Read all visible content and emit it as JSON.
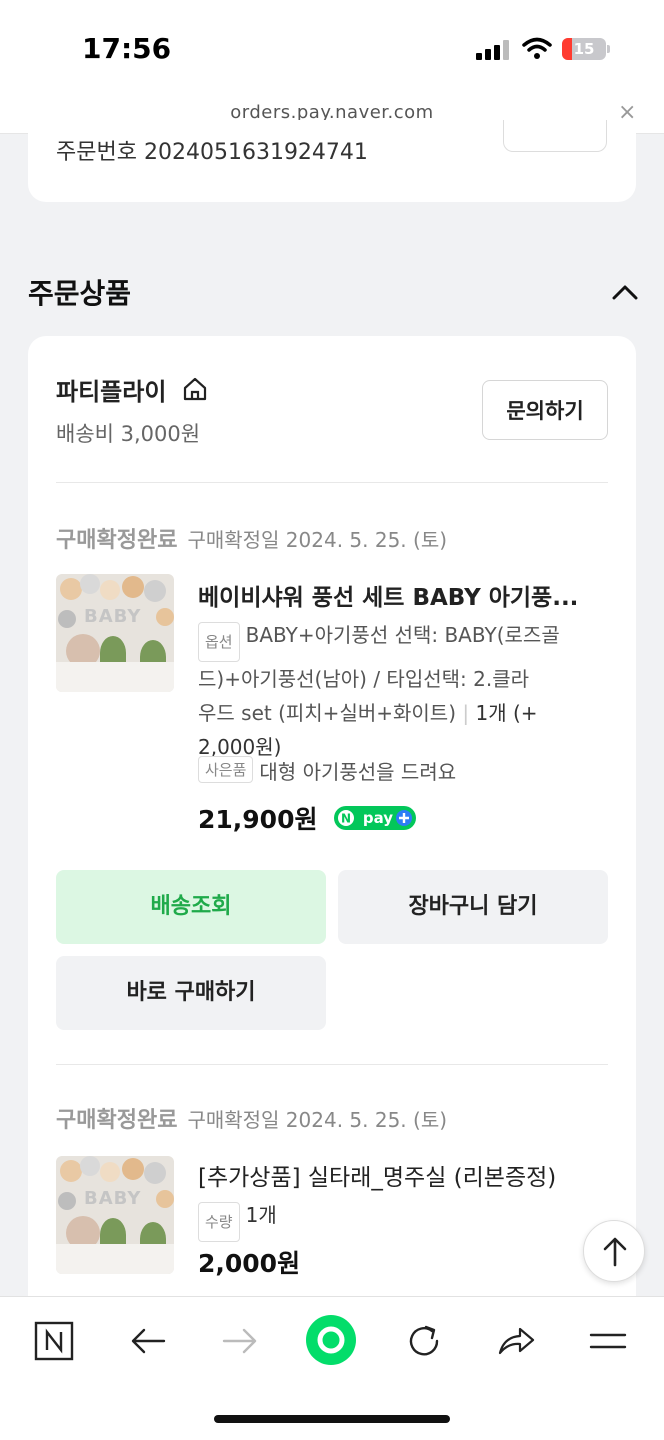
{
  "status_bar": {
    "time": "17:56",
    "battery": "15"
  },
  "browser": {
    "url": "orders.pay.naver.com"
  },
  "order": {
    "number_label": "주문번호",
    "number": "2024051631924741"
  },
  "section": {
    "title": "주문상품"
  },
  "seller": {
    "name": "파티플라이",
    "shipping_fee": "배송비 3,000원",
    "inquiry_label": "문의하기"
  },
  "items": [
    {
      "status": "구매확정완료",
      "date": "구매확정일 2024. 5. 25. (토)",
      "name": "베이비샤워 풍선 세트 BABY 아기풍...",
      "option_tag": "옵션",
      "option_lines": [
        "BABY+아기풍선 선택: BABY(로즈골",
        "드)+아기풍선(남아) / 타입선택: 2.클라",
        "우드 set (피치+실버+화이트)"
      ],
      "quantity": "1개 (+",
      "quantity_extra": "2,000원)",
      "gift_tag": "사은품",
      "gift": "대형 아기풍선을 드려요",
      "price": "21,900원",
      "npay": "N pay +"
    },
    {
      "status": "구매확정완료",
      "date": "구매확정일 2024. 5. 25. (토)",
      "name": "[추가상품] 실타래_명주실 (리본증정)",
      "qty_tag": "수량",
      "qty": "1개",
      "price": "2,000원"
    }
  ],
  "actions": {
    "track_delivery": "배송조회",
    "add_to_cart": "장바구니 담기",
    "buy_now": "바로 구매하기"
  },
  "colors": {
    "accent_green": "#1faa4a",
    "green_bg": "#dcf7e3",
    "npay_green": "#03c75a"
  }
}
